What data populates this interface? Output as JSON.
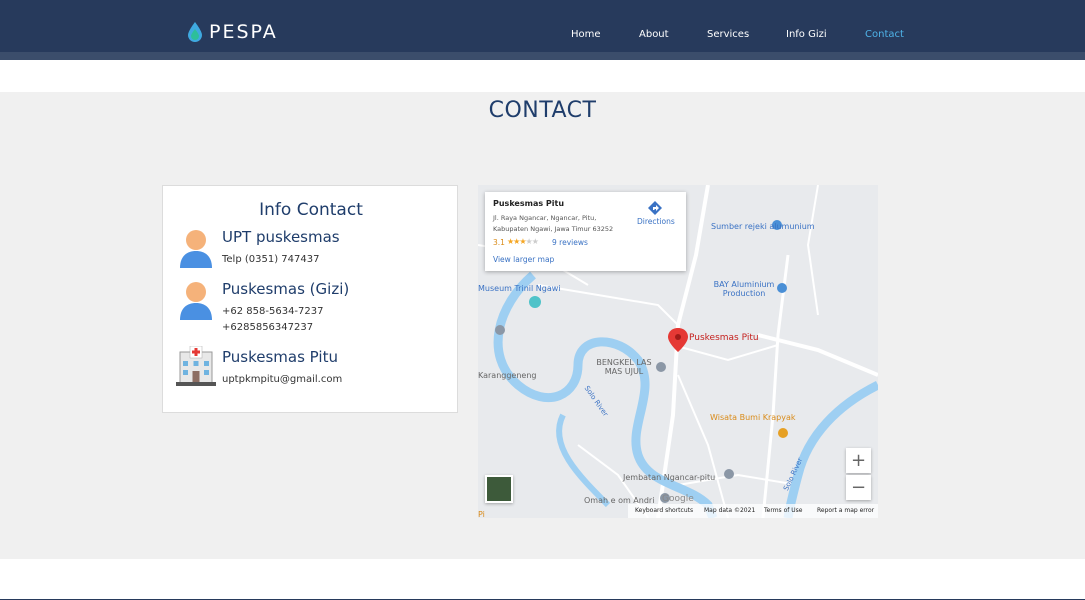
{
  "brand": {
    "name": "PESPA",
    "logo_icon": "water-drop-icon",
    "color": "#273a5c"
  },
  "nav": {
    "items": [
      {
        "label": "Home",
        "active": false
      },
      {
        "label": "About",
        "active": false
      },
      {
        "label": "Services",
        "active": false
      },
      {
        "label": "Info Gizi",
        "active": false
      },
      {
        "label": "Contact",
        "active": true
      }
    ],
    "active_color": "#4fb3e8"
  },
  "page": {
    "title": "CONTACT"
  },
  "contact_card": {
    "title": "Info Contact",
    "entries": [
      {
        "name": "UPT puskesmas",
        "icon": "person-icon",
        "lines": [
          "Telp (0351) 747437"
        ]
      },
      {
        "name": "Puskesmas (Gizi)",
        "icon": "person-icon",
        "lines": [
          "+62 858-5634-7237",
          "+6285856347237"
        ]
      },
      {
        "name": "Puskesmas Pitu",
        "icon": "hospital-icon",
        "lines": [
          "uptpkmpitu@gmail.com"
        ]
      }
    ]
  },
  "map": {
    "info_card": {
      "place_name": "Puskesmas Pitu",
      "address": "Jl. Raya Ngancar, Ngancar, Pitu, Kabupaten Ngawi, Jawa Timur 63252",
      "rating": "3.1",
      "rating_stars": 3,
      "reviews": "9 reviews",
      "view_larger": "View larger map",
      "directions": "Directions"
    },
    "labels": {
      "pin": "Puskesmas Pitu",
      "rejeki": "Sumber rejeki alumunium",
      "bay": "BAY Aluminium Production",
      "museum": "Museum Trinil Ngawi",
      "bengkel": "BENGKEL LAS MAS UJUL",
      "wisata": "Wisata Bumi Krapyak",
      "jembatan": "Jembatan Ngancar-pitu",
      "omah": "Omah e om Andri",
      "geneng": "Karanggeneng",
      "solo_river": "Solo River",
      "pi": "Pi"
    },
    "controls": {
      "zoom_in": "+",
      "zoom_out": "−"
    },
    "google": "Google",
    "footer": {
      "shortcuts": "Keyboard shortcuts",
      "map_data": "Map data ©2021",
      "terms": "Terms of Use",
      "report": "Report a map error"
    }
  }
}
